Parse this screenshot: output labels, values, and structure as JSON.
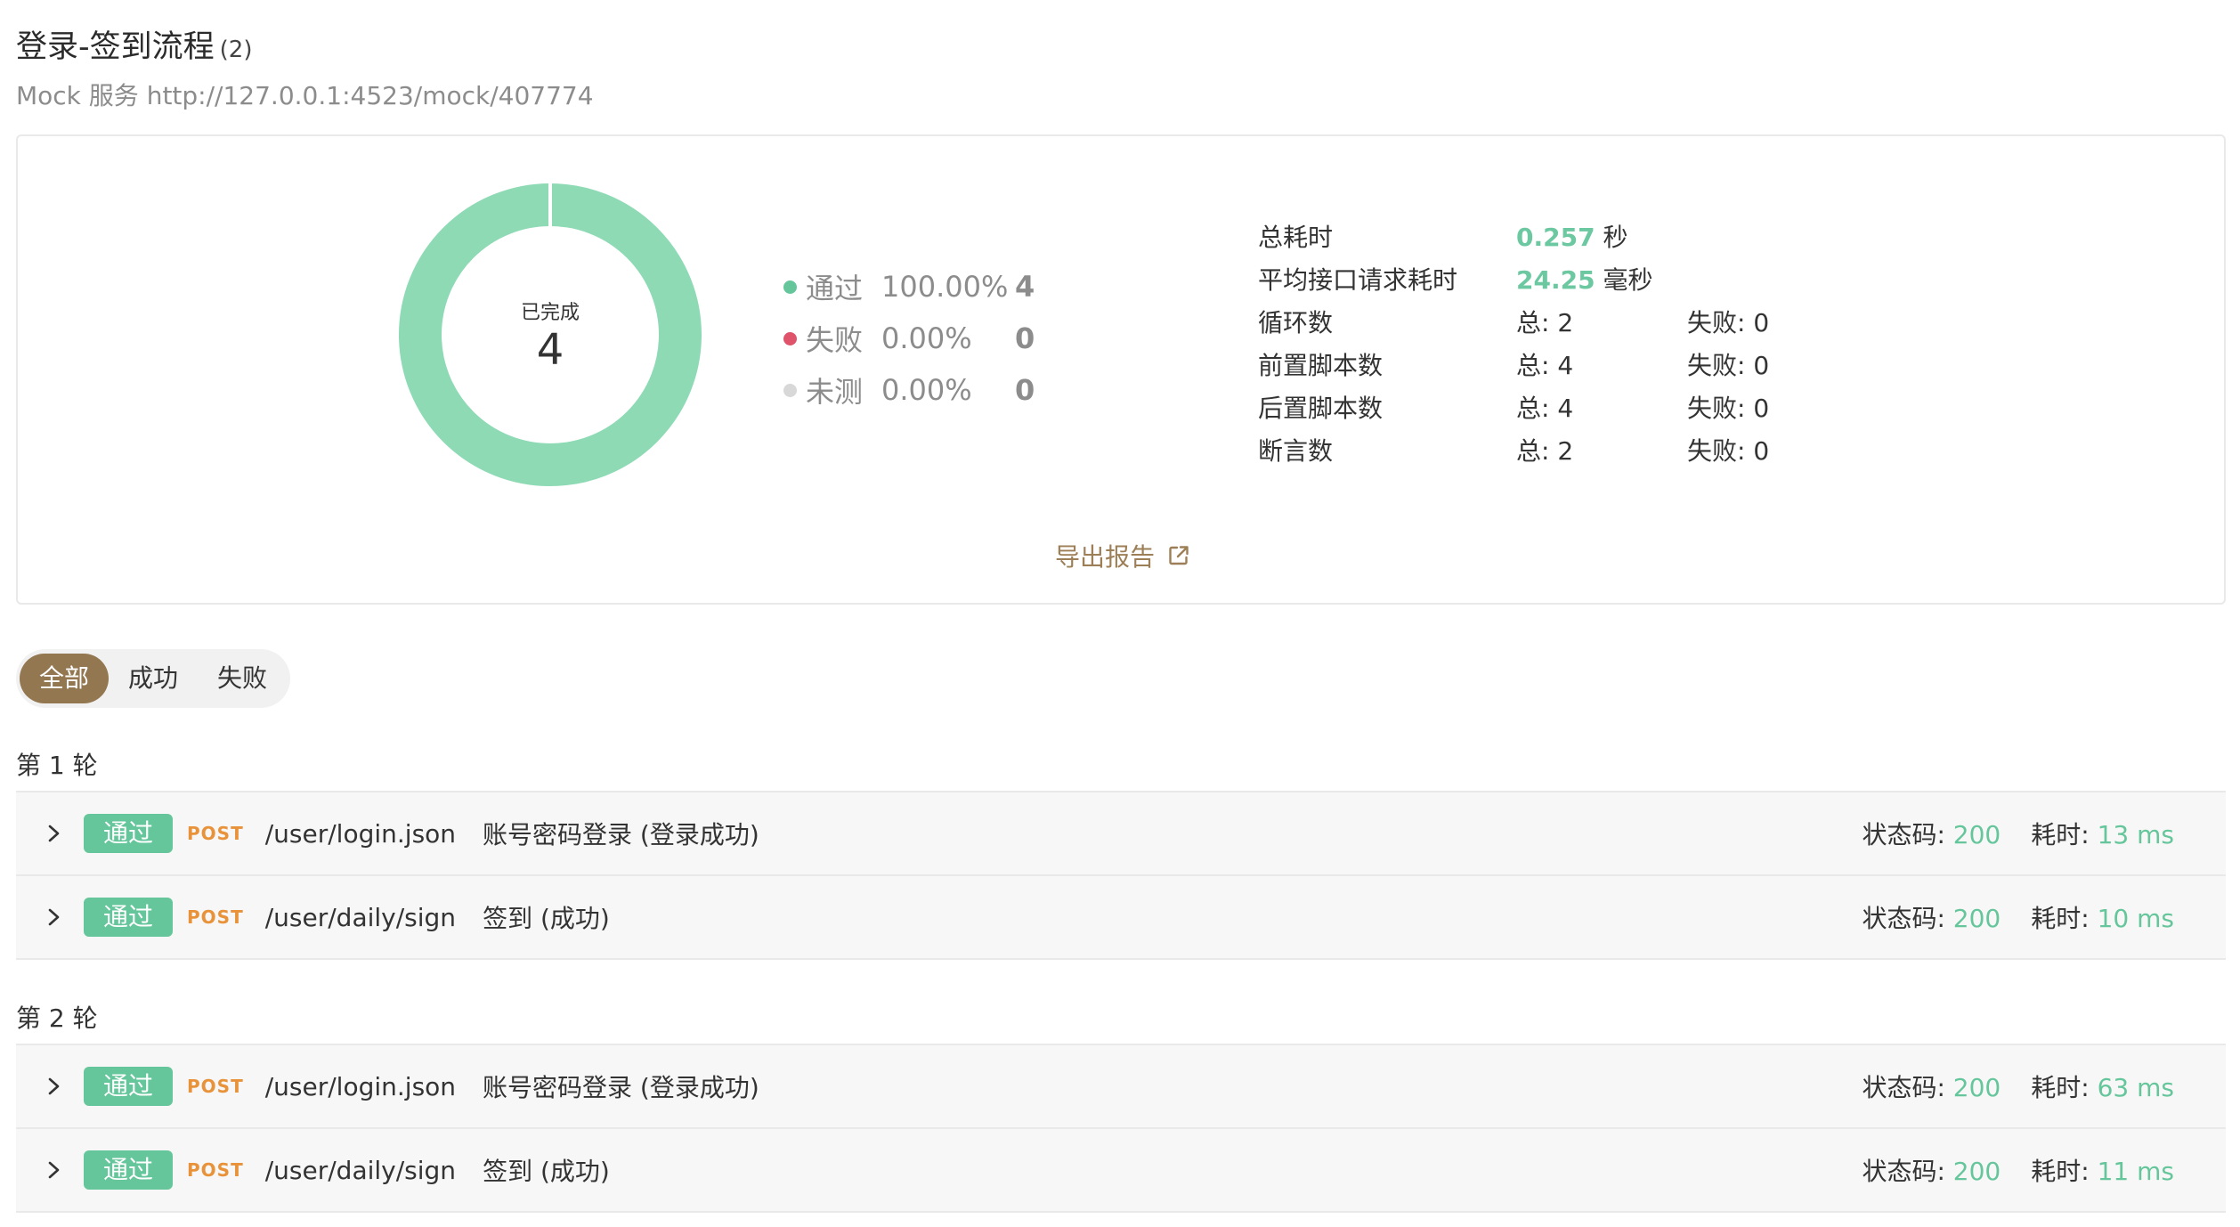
{
  "header": {
    "title": "登录-签到流程",
    "title_count": "(2)",
    "subtitle": "Mock 服务 http://127.0.0.1:4523/mock/407774"
  },
  "summary": {
    "donut": {
      "label": "已完成",
      "total": "4",
      "pass_fraction": 1.0,
      "color": "#8ddab4"
    },
    "legend": [
      {
        "name": "通过",
        "percent": "100.00%",
        "count": "4",
        "color": "#66c69b"
      },
      {
        "name": "失败",
        "percent": "0.00%",
        "count": "0",
        "color": "#e0546b"
      },
      {
        "name": "未测",
        "percent": "0.00%",
        "count": "0",
        "color": "#d8d8d8"
      }
    ],
    "stats": {
      "total_time": {
        "label": "总耗时",
        "value": "0.257",
        "unit": "秒"
      },
      "avg_time": {
        "label": "平均接口请求耗时",
        "value": "24.25",
        "unit": "毫秒"
      },
      "loops": {
        "label": "循环数",
        "total": "总: 2",
        "failed": "失败: 0"
      },
      "pre_scripts": {
        "label": "前置脚本数",
        "total": "总: 4",
        "failed": "失败: 0"
      },
      "post_scripts": {
        "label": "后置脚本数",
        "total": "总: 4",
        "failed": "失败: 0"
      },
      "assertions": {
        "label": "断言数",
        "total": "总: 2",
        "failed": "失败: 0"
      }
    },
    "export_label": "导出报告"
  },
  "filter": {
    "all": "全部",
    "success": "成功",
    "failed": "失败",
    "selected": "全部"
  },
  "rounds": [
    {
      "label": "第 1 轮",
      "requests": [
        {
          "status": "通过",
          "method": "POST",
          "path": "/user/login.json",
          "desc": "账号密码登录 (登录成功)",
          "code_label": "状态码:",
          "code": "200",
          "time_label": "耗时:",
          "time": "13 ms"
        },
        {
          "status": "通过",
          "method": "POST",
          "path": "/user/daily/sign",
          "desc": "签到 (成功)",
          "code_label": "状态码:",
          "code": "200",
          "time_label": "耗时:",
          "time": "10 ms"
        }
      ]
    },
    {
      "label": "第 2 轮",
      "requests": [
        {
          "status": "通过",
          "method": "POST",
          "path": "/user/login.json",
          "desc": "账号密码登录 (登录成功)",
          "code_label": "状态码:",
          "code": "200",
          "time_label": "耗时:",
          "time": "63 ms"
        },
        {
          "status": "通过",
          "method": "POST",
          "path": "/user/daily/sign",
          "desc": "签到 (成功)",
          "code_label": "状态码:",
          "code": "200",
          "time_label": "耗时:",
          "time": "11 ms"
        }
      ]
    }
  ]
}
